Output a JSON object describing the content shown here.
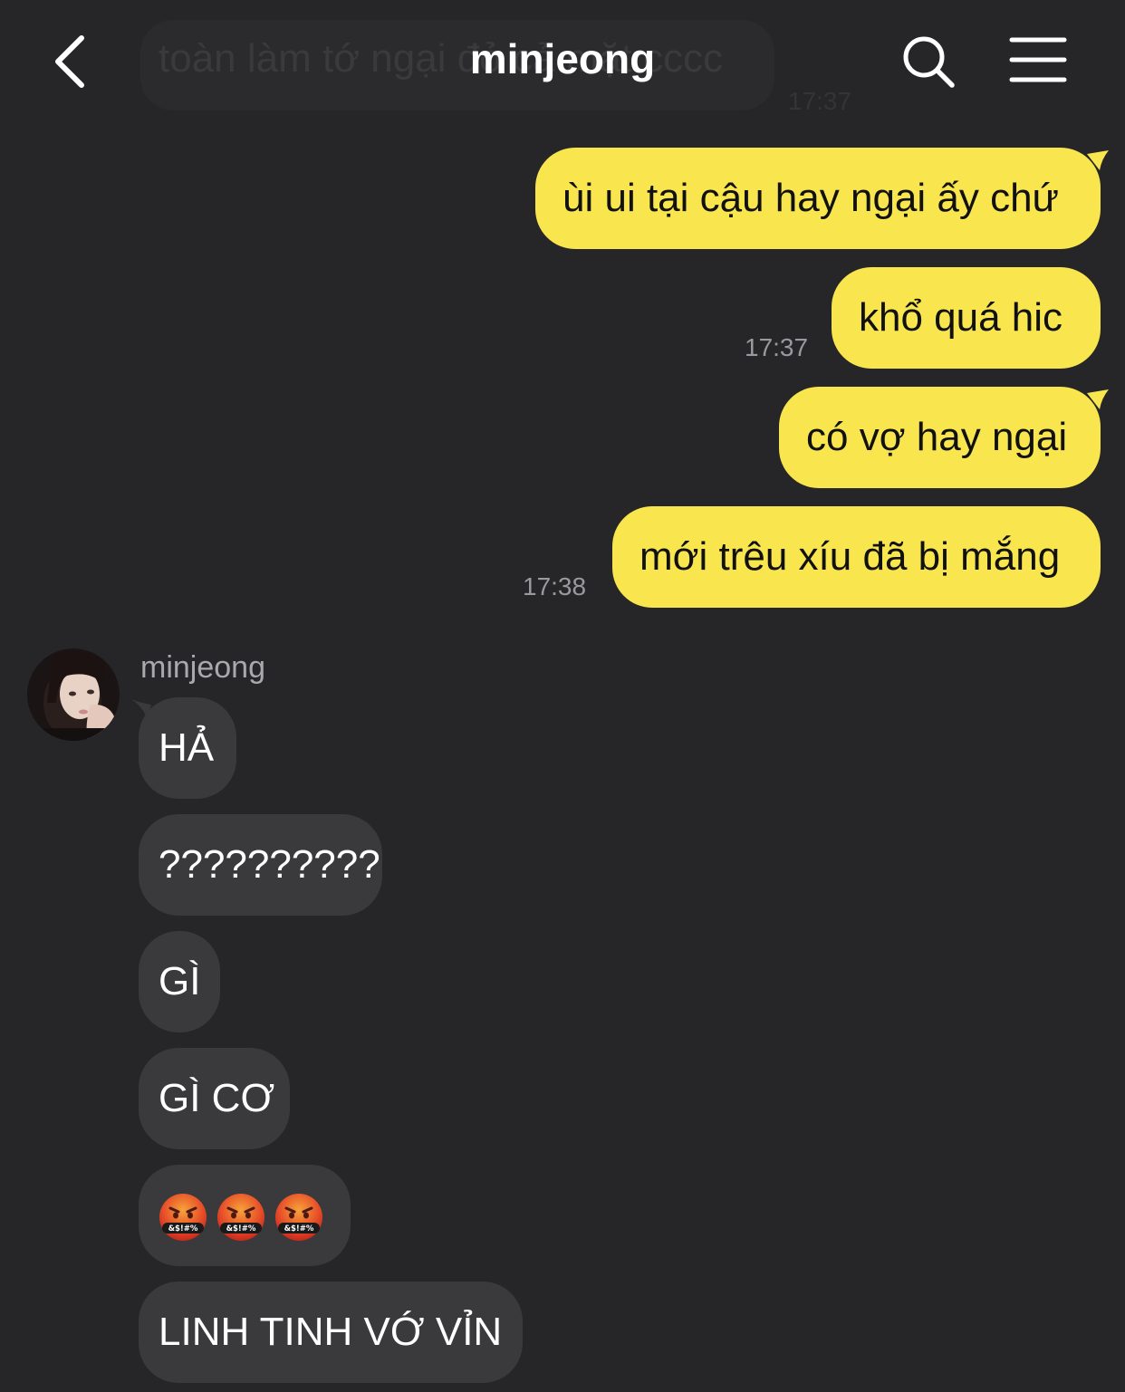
{
  "header": {
    "title": "minjeong"
  },
  "ghost_message": {
    "text": "toàn làm tớ ngại đỏ cả mặt cccc",
    "time": "17:37"
  },
  "messages_out": [
    {
      "text": "ùi ui tại cậu hay ngại ấy chứ"
    },
    {
      "text": "khổ quá hic",
      "time": "17:37"
    },
    {
      "text": "có vợ hay ngại"
    },
    {
      "text": "mới trêu xíu đã bị mắng",
      "time": "17:38"
    }
  ],
  "sender": {
    "name": "minjeong"
  },
  "messages_in": [
    {
      "text": "HẢ"
    },
    {
      "text": "??????????"
    },
    {
      "text": "GÌ"
    },
    {
      "text": "GÌ CƠ"
    },
    {
      "emoji": [
        "face-with-symbols-on-mouth",
        "face-with-symbols-on-mouth",
        "face-with-symbols-on-mouth"
      ],
      "emoji_text": "&$!#%"
    },
    {
      "text": "LINH TINH VỚ VỈN"
    }
  ],
  "colors": {
    "background": "#262628",
    "outgoing_bubble": "#f9e64f",
    "incoming_bubble": "#3a3a3c",
    "timestamp": "#9a9a9e"
  },
  "icons": {
    "back": "chevron-left-icon",
    "search": "search-icon",
    "menu": "hamburger-menu-icon"
  }
}
